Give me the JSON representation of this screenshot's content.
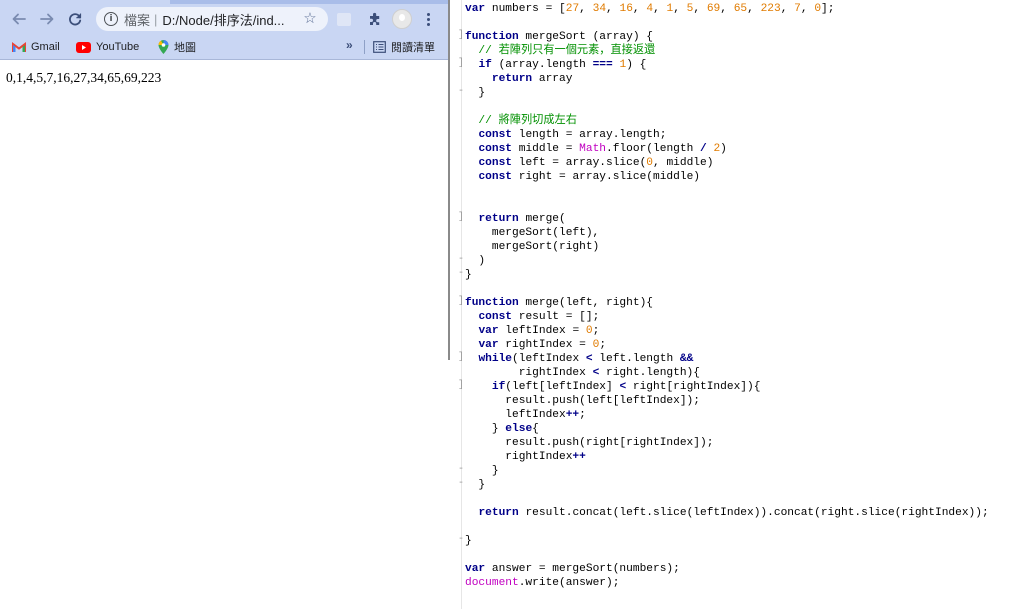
{
  "browser": {
    "address_scheme": "檔案",
    "address_separator": "|",
    "address_url": "D:/Node/排序法/ind...",
    "bookmarks": [
      {
        "label": "Gmail"
      },
      {
        "label": "YouTube"
      },
      {
        "label": "地圖"
      }
    ],
    "bookmarks_more": "»",
    "reading_list": "閱讀清單",
    "page_output": "0,1,4,5,7,16,27,34,65,69,223"
  },
  "colors": {
    "toolbar_bg": "#c9d6f3",
    "keyword": "#000088",
    "number": "#e07b00",
    "comment": "#009000",
    "builtin": "#c000c0"
  },
  "editor": {
    "lines": [
      [
        {
          "t": "var",
          "c": "k"
        },
        {
          "t": " numbers = [",
          "c": ""
        },
        {
          "t": "27",
          "c": "n"
        },
        {
          "t": ", ",
          "c": ""
        },
        {
          "t": "34",
          "c": "n"
        },
        {
          "t": ", ",
          "c": ""
        },
        {
          "t": "16",
          "c": "n"
        },
        {
          "t": ", ",
          "c": ""
        },
        {
          "t": "4",
          "c": "n"
        },
        {
          "t": ", ",
          "c": ""
        },
        {
          "t": "1",
          "c": "n"
        },
        {
          "t": ", ",
          "c": ""
        },
        {
          "t": "5",
          "c": "n"
        },
        {
          "t": ", ",
          "c": ""
        },
        {
          "t": "69",
          "c": "n"
        },
        {
          "t": ", ",
          "c": ""
        },
        {
          "t": "65",
          "c": "n"
        },
        {
          "t": ", ",
          "c": ""
        },
        {
          "t": "223",
          "c": "n"
        },
        {
          "t": ", ",
          "c": ""
        },
        {
          "t": "7",
          "c": "n"
        },
        {
          "t": ", ",
          "c": ""
        },
        {
          "t": "0",
          "c": "n"
        },
        {
          "t": "];",
          "c": ""
        }
      ],
      [],
      [
        {
          "t": "function",
          "c": "k"
        },
        {
          "t": " mergeSort (array) {",
          "c": ""
        }
      ],
      [
        {
          "t": "  // 若陣列只有一個元素，直接返還",
          "c": "c"
        }
      ],
      [
        {
          "t": "  ",
          "c": ""
        },
        {
          "t": "if",
          "c": "k"
        },
        {
          "t": " (array.length ",
          "c": ""
        },
        {
          "t": "===",
          "c": "o"
        },
        {
          "t": " ",
          "c": ""
        },
        {
          "t": "1",
          "c": "n"
        },
        {
          "t": ") {",
          "c": ""
        }
      ],
      [
        {
          "t": "    ",
          "c": ""
        },
        {
          "t": "return",
          "c": "k"
        },
        {
          "t": " array",
          "c": ""
        }
      ],
      [
        {
          "t": "  }",
          "c": ""
        }
      ],
      [],
      [
        {
          "t": "  // 將陣列切成左右",
          "c": "c"
        }
      ],
      [
        {
          "t": "  ",
          "c": ""
        },
        {
          "t": "const",
          "c": "k"
        },
        {
          "t": " length = array.length;",
          "c": ""
        }
      ],
      [
        {
          "t": "  ",
          "c": ""
        },
        {
          "t": "const",
          "c": "k"
        },
        {
          "t": " middle = ",
          "c": ""
        },
        {
          "t": "Math",
          "c": "m"
        },
        {
          "t": ".floor(length ",
          "c": ""
        },
        {
          "t": "/",
          "c": "o"
        },
        {
          "t": " ",
          "c": ""
        },
        {
          "t": "2",
          "c": "n"
        },
        {
          "t": ")",
          "c": ""
        }
      ],
      [
        {
          "t": "  ",
          "c": ""
        },
        {
          "t": "const",
          "c": "k"
        },
        {
          "t": " left = array.slice(",
          "c": ""
        },
        {
          "t": "0",
          "c": "n"
        },
        {
          "t": ", middle)",
          "c": ""
        }
      ],
      [
        {
          "t": "  ",
          "c": ""
        },
        {
          "t": "const",
          "c": "k"
        },
        {
          "t": " right = array.slice(middle)",
          "c": ""
        }
      ],
      [],
      [],
      [
        {
          "t": "  ",
          "c": ""
        },
        {
          "t": "return",
          "c": "k"
        },
        {
          "t": " merge(",
          "c": ""
        }
      ],
      [
        {
          "t": "    mergeSort(left),",
          "c": ""
        }
      ],
      [
        {
          "t": "    mergeSort(right)",
          "c": ""
        }
      ],
      [
        {
          "t": "  )",
          "c": ""
        }
      ],
      [
        {
          "t": "}",
          "c": ""
        }
      ],
      [],
      [
        {
          "t": "function",
          "c": "k"
        },
        {
          "t": " merge(left, right){",
          "c": ""
        }
      ],
      [
        {
          "t": "  ",
          "c": ""
        },
        {
          "t": "const",
          "c": "k"
        },
        {
          "t": " result = [];",
          "c": ""
        }
      ],
      [
        {
          "t": "  ",
          "c": ""
        },
        {
          "t": "var",
          "c": "k"
        },
        {
          "t": " leftIndex = ",
          "c": ""
        },
        {
          "t": "0",
          "c": "n"
        },
        {
          "t": ";",
          "c": ""
        }
      ],
      [
        {
          "t": "  ",
          "c": ""
        },
        {
          "t": "var",
          "c": "k"
        },
        {
          "t": " rightIndex = ",
          "c": ""
        },
        {
          "t": "0",
          "c": "n"
        },
        {
          "t": ";",
          "c": ""
        }
      ],
      [
        {
          "t": "  ",
          "c": ""
        },
        {
          "t": "while",
          "c": "k"
        },
        {
          "t": "(leftIndex ",
          "c": ""
        },
        {
          "t": "<",
          "c": "o"
        },
        {
          "t": " left.length ",
          "c": ""
        },
        {
          "t": "&&",
          "c": "o"
        }
      ],
      [
        {
          "t": "        rightIndex ",
          "c": ""
        },
        {
          "t": "<",
          "c": "o"
        },
        {
          "t": " right.length){",
          "c": ""
        }
      ],
      [
        {
          "t": "    ",
          "c": ""
        },
        {
          "t": "if",
          "c": "k"
        },
        {
          "t": "(left[leftIndex] ",
          "c": ""
        },
        {
          "t": "<",
          "c": "o"
        },
        {
          "t": " right[rightIndex]){",
          "c": ""
        }
      ],
      [
        {
          "t": "      result.push(left[leftIndex]);",
          "c": ""
        }
      ],
      [
        {
          "t": "      leftIndex",
          "c": ""
        },
        {
          "t": "++",
          "c": "o"
        },
        {
          "t": ";",
          "c": ""
        }
      ],
      [
        {
          "t": "    } ",
          "c": ""
        },
        {
          "t": "else",
          "c": "k"
        },
        {
          "t": "{",
          "c": ""
        }
      ],
      [
        {
          "t": "      result.push(right[rightIndex]);",
          "c": ""
        }
      ],
      [
        {
          "t": "      rightIndex",
          "c": ""
        },
        {
          "t": "++",
          "c": "o"
        }
      ],
      [
        {
          "t": "    }",
          "c": ""
        }
      ],
      [
        {
          "t": "  }",
          "c": ""
        }
      ],
      [],
      [
        {
          "t": "  ",
          "c": ""
        },
        {
          "t": "return",
          "c": "k"
        },
        {
          "t": " result.concat(left.slice(leftIndex)).concat(right.slice(rightIndex));",
          "c": ""
        }
      ],
      [],
      [
        {
          "t": "}",
          "c": ""
        }
      ],
      [],
      [
        {
          "t": "var",
          "c": "k"
        },
        {
          "t": " answer = mergeSort(numbers);",
          "c": ""
        }
      ],
      [
        {
          "t": "document",
          "c": "m"
        },
        {
          "t": ".write(answer);",
          "c": ""
        }
      ]
    ],
    "fold_markers": [
      {
        "line": 2,
        "glyph": "]"
      },
      {
        "line": 4,
        "glyph": "]"
      },
      {
        "line": 6,
        "glyph": "-"
      },
      {
        "line": 15,
        "glyph": "]"
      },
      {
        "line": 18,
        "glyph": "-"
      },
      {
        "line": 19,
        "glyph": "-"
      },
      {
        "line": 21,
        "glyph": "]"
      },
      {
        "line": 25,
        "glyph": "]"
      },
      {
        "line": 27,
        "glyph": "]"
      },
      {
        "line": 33,
        "glyph": "-"
      },
      {
        "line": 34,
        "glyph": "-"
      },
      {
        "line": 38,
        "glyph": "-"
      }
    ]
  }
}
